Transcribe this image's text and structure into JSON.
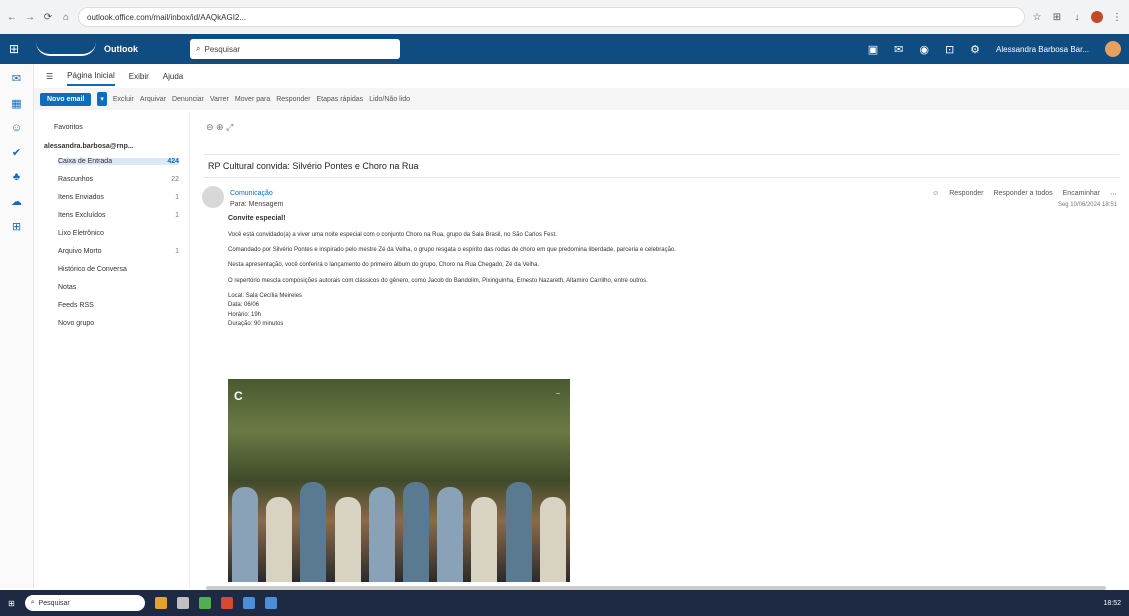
{
  "browser": {
    "url": "outlook.office.com/mail/inbox/id/AAQkAGI2..."
  },
  "header": {
    "app_name": "Outlook",
    "search_placeholder": "Pesquisar",
    "user_name": "Alessandra Barbosa Bar..."
  },
  "tabs": [
    "Página Inicial",
    "Exibir",
    "Ajuda"
  ],
  "ribbon": {
    "new_mail": "Novo email",
    "items": [
      "Excluir",
      "Arquivar",
      "Denunciar",
      "Varrer",
      "Mover para",
      "Responder",
      "Etapas rápidas",
      "Lido/Não lido"
    ]
  },
  "folders": {
    "favorites": "Favoritos",
    "account": "alessandra.barbosa@rnp...",
    "items": [
      {
        "label": "Caixa de Entrada",
        "count": "424"
      },
      {
        "label": "Rascunhos",
        "count": "22"
      },
      {
        "label": "Itens Enviados",
        "count": "1"
      },
      {
        "label": "Itens Excluídos",
        "count": "1"
      },
      {
        "label": "Lixo Eletrônico",
        "count": ""
      },
      {
        "label": "Arquivo Morto",
        "count": "1"
      },
      {
        "label": "Histórico de Conversa",
        "count": ""
      },
      {
        "label": "Notas",
        "count": ""
      },
      {
        "label": "Feeds RSS",
        "count": ""
      },
      {
        "label": "Novo grupo",
        "count": ""
      }
    ]
  },
  "message": {
    "subject": "RP Cultural convida: Silvério Pontes e Choro na Rua",
    "sender": "Comunicação",
    "to": "Para: Mensagem",
    "date": "Seg 10/06/2024 18:51",
    "actions": [
      "Responder",
      "Responder a todos",
      "Encaminhar"
    ],
    "lead": "Convite especial!",
    "p1": "Você está convidado(a) a viver uma noite especial com o conjunto Choro na Rua, grupo da Sala Brasil, no São Carlos Fest.",
    "p2": "Comandado por Silvério Pontes e inspirado pelo mestre Zé da Velha, o grupo resgata o espírito das rodas de choro em que predomina liberdade, parceria e celebração.",
    "p3": "Nesta apresentação, você conferirá o lançamento do primeiro álbum do grupo, Choro na Rua Chegado, Zé da Velha.",
    "p4": "O repertório mescla composições autorais com clássicos do gênero, como Jacob do Bandolim, Pixinguinha, Ernesto Nazareth, Altamiro Carrilho, entre outros.",
    "details": [
      "Local: Sala Cecília Meireles",
      "Data: 06/06",
      "Horário: 19h",
      "Duração: 90 minutos"
    ],
    "photo_label": "C"
  },
  "taskbar": {
    "search": "Pesquisar",
    "time": "18:52"
  }
}
